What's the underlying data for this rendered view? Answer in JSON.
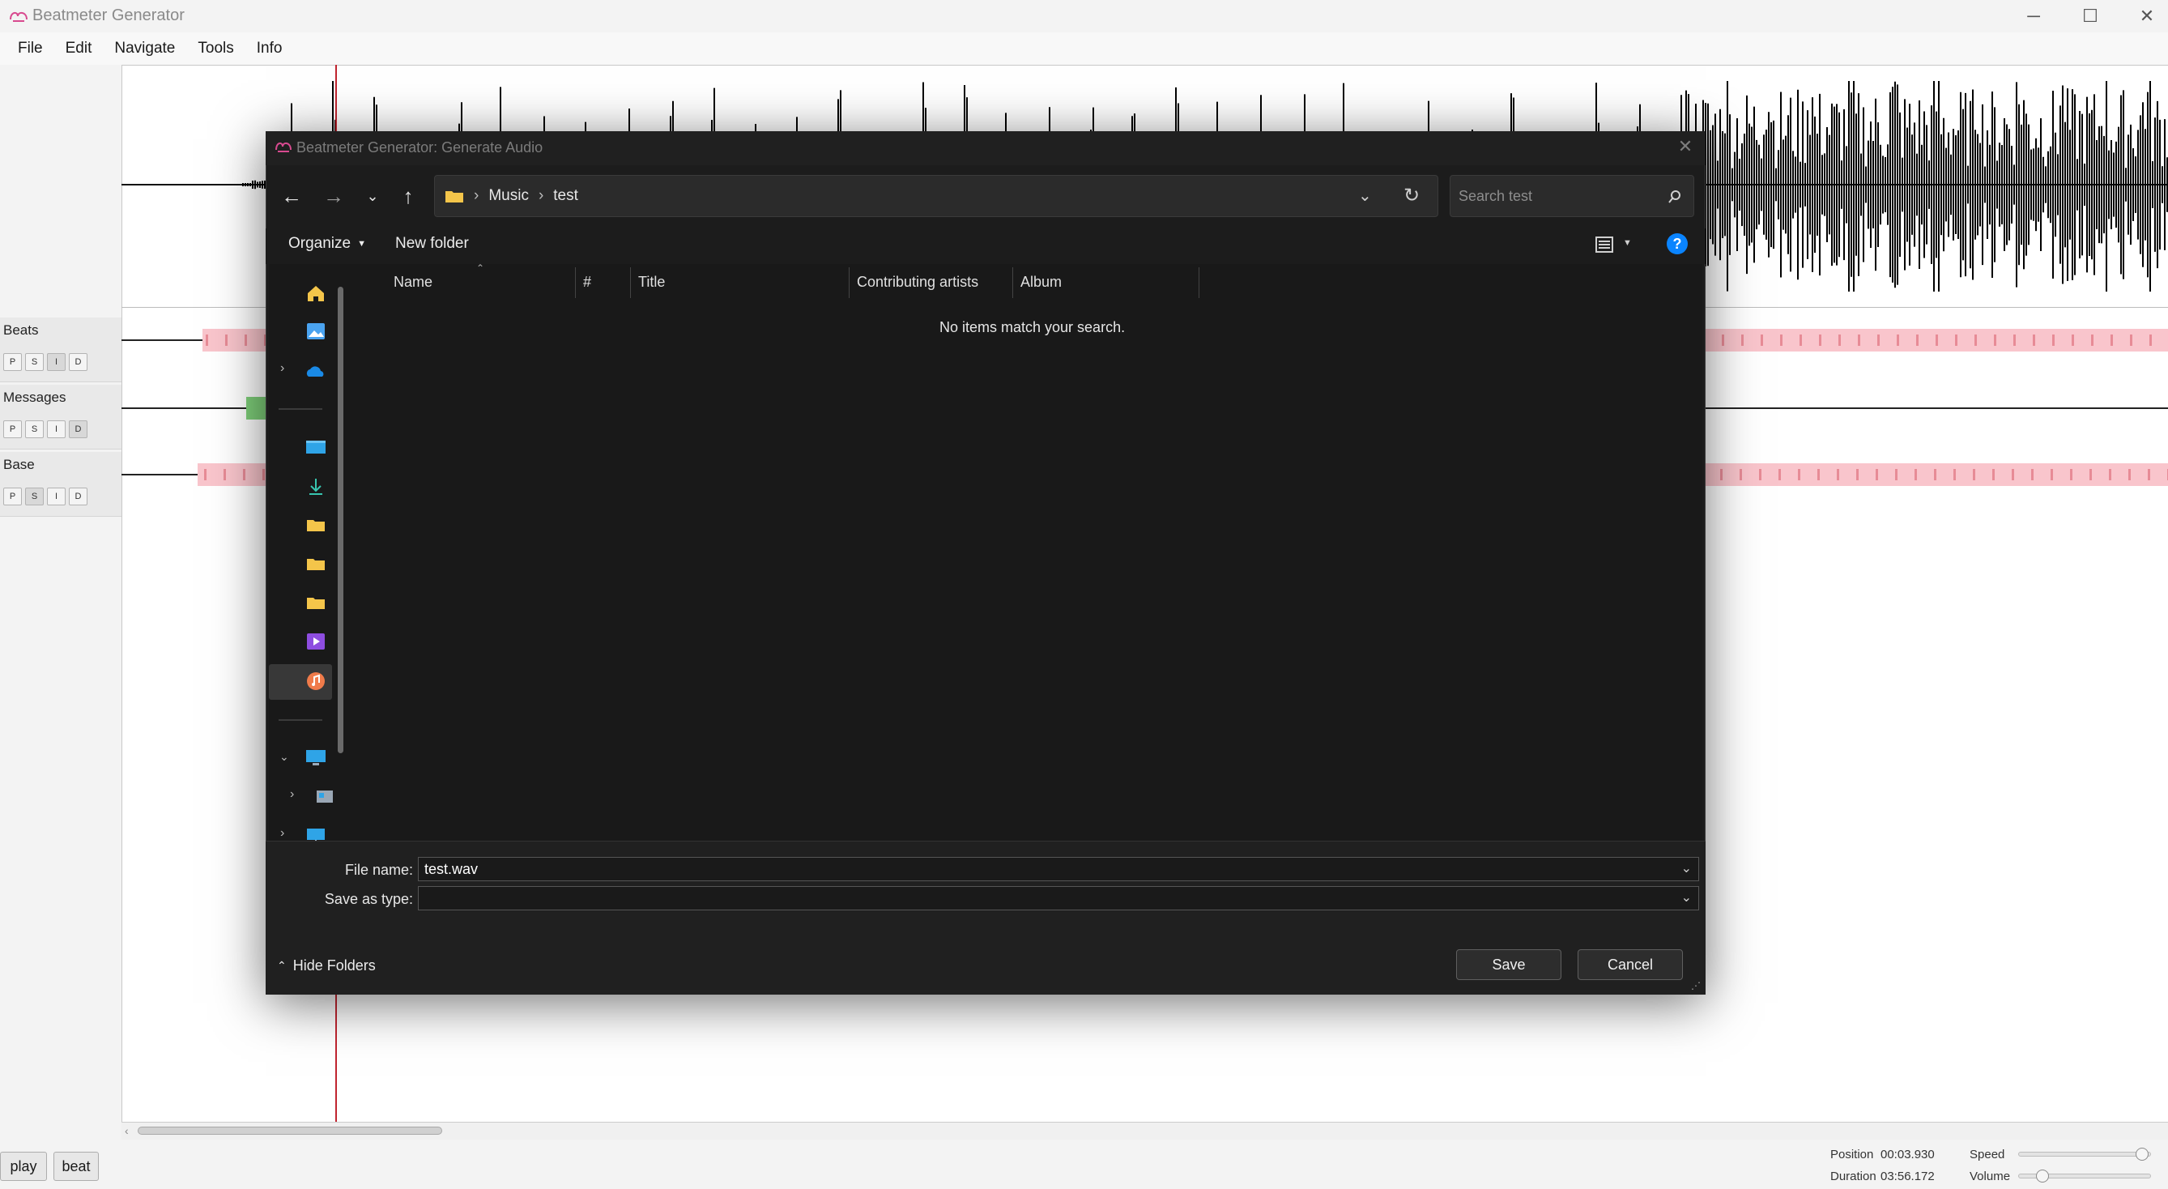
{
  "window": {
    "title": "Beatmeter Generator",
    "minimize_icon": "minimize-icon",
    "maximize_icon": "maximize-icon",
    "close_icon": "close-icon"
  },
  "menu": [
    "File",
    "Edit",
    "Navigate",
    "Tools",
    "Info"
  ],
  "tracks": [
    {
      "name": "Beats",
      "buttons": [
        "P",
        "S",
        "I",
        "D"
      ],
      "active": [
        "I"
      ]
    },
    {
      "name": "Messages",
      "buttons": [
        "P",
        "S",
        "I",
        "D"
      ],
      "active": [
        "D"
      ]
    },
    {
      "name": "Base",
      "buttons": [
        "P",
        "S",
        "I",
        "D"
      ],
      "active": [
        "S"
      ]
    }
  ],
  "controls": {
    "play_label": "play",
    "beat_label": "beat",
    "position_label": "Position",
    "position_value": "00:03.930",
    "duration_label": "Duration",
    "duration_value": "03:56.172",
    "speed_label": "Speed",
    "volume_label": "Volume",
    "speed_level": 0.98,
    "volume_level": 0.15
  },
  "colors": {
    "playhead": "#c0242f",
    "beat_band": "#f9c5cc",
    "message_marker": "#7fd07a",
    "accent": "#0a84ff"
  },
  "dialog": {
    "title": "Beatmeter Generator: Generate Audio",
    "breadcrumb": [
      "Music",
      "test"
    ],
    "search_placeholder": "Search test",
    "organize_label": "Organize",
    "new_folder_label": "New folder",
    "columns": [
      "Name",
      "#",
      "Title",
      "Contributing artists",
      "Album"
    ],
    "empty_message": "No items match your search.",
    "file_name_label": "File name:",
    "file_name_value": "test.wav",
    "save_as_type_label": "Save as type:",
    "save_as_type_value": "",
    "hide_folders_label": "Hide Folders",
    "save_label": "Save",
    "cancel_label": "Cancel",
    "nav_icons": [
      "home-icon",
      "gallery-icon",
      "onedrive-icon",
      "desktop-icon",
      "downloads-icon",
      "folder-icon",
      "folder-icon",
      "folder-icon",
      "videos-icon",
      "music-icon",
      "this-pc-icon",
      "drive-icon",
      "network-drive-icon"
    ]
  }
}
